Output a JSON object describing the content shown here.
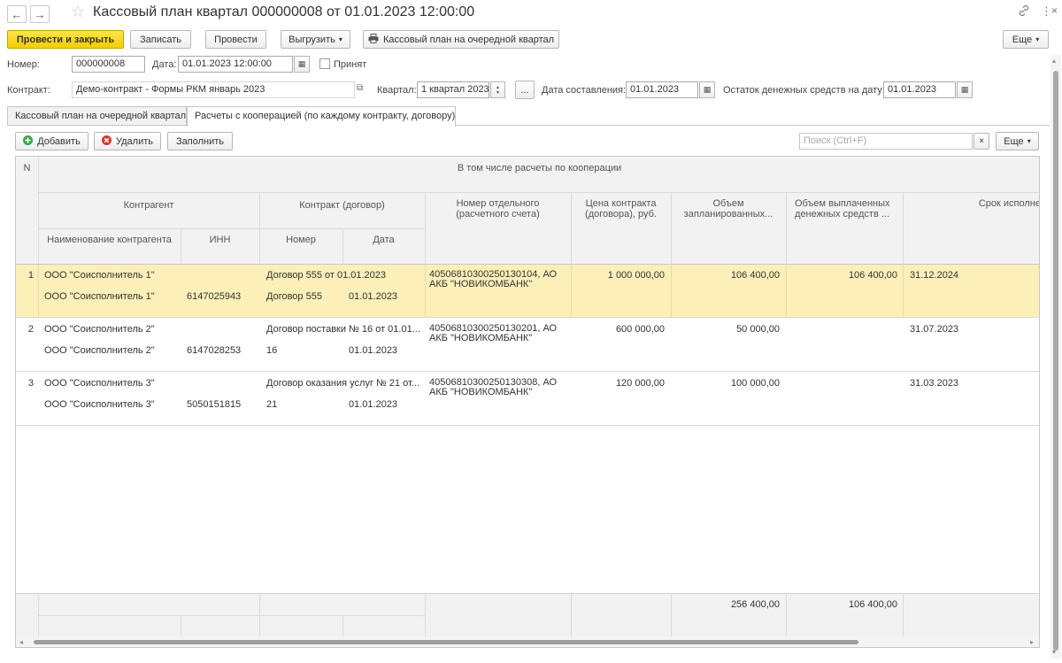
{
  "title": "Кассовый план квартал 000000008 от 01.01.2023 12:00:00",
  "nav": {
    "back": "←",
    "forward": "→"
  },
  "toolbar": {
    "post_close": "Провести и закрыть",
    "save": "Записать",
    "post": "Провести",
    "export": "Выгрузить",
    "print_plan": "Кассовый план на очередной квартал",
    "more": "Еще"
  },
  "header": {
    "number_label": "Номер:",
    "number_value": "000000008",
    "date_label": "Дата:",
    "date_value": "01.01.2023 12:00:00",
    "accepted_label": "Принят",
    "contract_label": "Контракт:",
    "contract_value": "Демо-контракт - Формы РКМ январь 2023",
    "quarter_label": "Квартал:",
    "quarter_value": "1 квартал 2023",
    "ellipsis": "...",
    "compile_date_label": "Дата составления:",
    "compile_date_value": "01.01.2023",
    "balance_label": "Остаток денежных средств на дату:",
    "balance_value": "01.01.2023"
  },
  "tabs": [
    {
      "label": "Кассовый план на очередной квартал"
    },
    {
      "label": "Расчеты с кооперацией (по каждому контракту, договору)"
    }
  ],
  "table_toolbar": {
    "add": "Добавить",
    "delete": "Удалить",
    "fill": "Заполнить",
    "search_placeholder": "Поиск (Ctrl+F)",
    "clear": "×",
    "more": "Еще"
  },
  "table": {
    "headers": {
      "n": "N",
      "group": "В том числе расчеты по кооперации",
      "counterparty": "Контрагент",
      "contract": "Контракт (договор)",
      "account": "Номер отдельного (расчетного счета)",
      "price": "Цена контракта (договора), руб.",
      "planned": "Объем запланированных...",
      "paid": "Объем выплаченных денежных средств ...",
      "deadline": "Срок исполне",
      "cp_name": "Наименование контрагента",
      "inn": "ИНН",
      "number": "Номер",
      "date": "Дата"
    },
    "rows": [
      {
        "n": "1",
        "cp1": "ООО \"Соисполнитель 1\"",
        "contract1": "Договор 555 от 01.01.2023",
        "account": "40506810300250130104, АО АКБ \"НОВИКОМБАНК\"",
        "price": "1 000 000,00",
        "planned": "106 400,00",
        "paid": "106 400,00",
        "deadline": "31.12.2024",
        "cp2": "ООО \"Соисполнитель 1\"",
        "inn": "6147025943",
        "num": "Договор 555",
        "date": "01.01.2023"
      },
      {
        "n": "2",
        "cp1": "ООО \"Соисполнитель 2\"",
        "contract1": "Договор поставки № 16 от 01.01...",
        "account": "40506810300250130201, АО АКБ \"НОВИКОМБАНК\"",
        "price": "600 000,00",
        "planned": "50 000,00",
        "paid": "",
        "deadline": "31.07.2023",
        "cp2": "ООО \"Соисполнитель 2\"",
        "inn": "6147028253",
        "num": "16",
        "date": "01.01.2023"
      },
      {
        "n": "3",
        "cp1": "ООО \"Соисполнитель 3\"",
        "contract1": "Договор оказания услуг № 21 от...",
        "account": "40506810300250130308, АО АКБ \"НОВИКОМБАНК\"",
        "price": "120 000,00",
        "planned": "100 000,00",
        "paid": "",
        "deadline": "31.03.2023",
        "cp2": "ООО \"Соисполнитель 3\"",
        "inn": "5050151815",
        "num": "21",
        "date": "01.01.2023"
      }
    ],
    "totals": {
      "planned": "256 400,00",
      "paid": "106 400,00"
    }
  }
}
